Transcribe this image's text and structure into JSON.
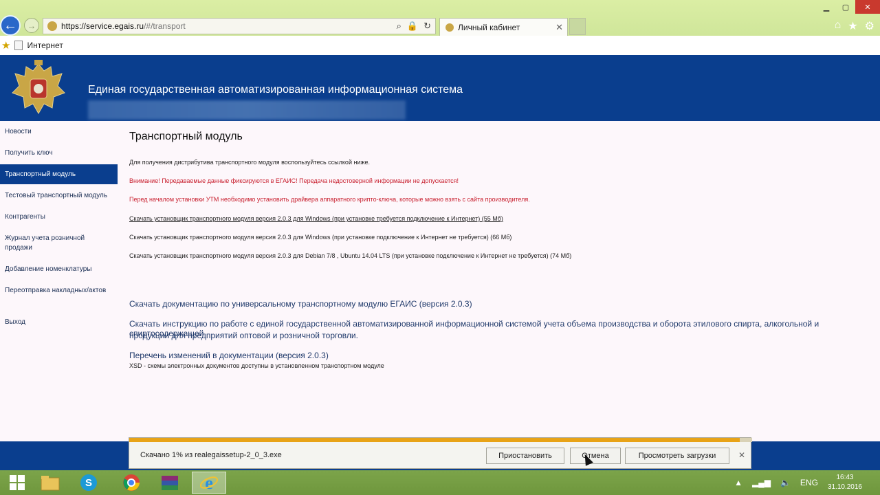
{
  "browser": {
    "url_host": "https://service.egais.ru",
    "url_rest": "/#/transport",
    "tab_title": "Личный кабинет",
    "favorites_label": "Интернет"
  },
  "header": {
    "title": "Единая государственная автоматизированная информационная система"
  },
  "sidebar": {
    "items": [
      {
        "label": "Новости"
      },
      {
        "label": "Получить ключ"
      },
      {
        "label": "Транспортный модуль"
      },
      {
        "label": "Тестовый транспортный модуль"
      },
      {
        "label": "Контрагенты"
      },
      {
        "label": "Журнал учета розничной продажи"
      },
      {
        "label": "Добавление номенклатуры"
      },
      {
        "label": "Переотправка накладных/актов"
      },
      {
        "label": "Выход"
      }
    ]
  },
  "main": {
    "title": "Транспортный модуль",
    "intro": "Для получения дистрибутива транспортного модуля воспользуйтесь ссылкой ниже.",
    "warning1": "Внимание! Передаваемые данные фиксируются в ЕГАИС! Передача недостоверной информации не допускается!",
    "warning2": "Перед началом установки УТМ необходимо установить драйвера аппаратного крипто-ключа, которые можно взять с сайта производителя.",
    "link1": "Скачать установщик транспортного модуля версия 2.0.3 для Windows (при установке требуется подключение к Интернет) (55 Мб)",
    "link2": "Скачать установщик транспортного модуля версия 2.0.3 для Windows (при установке подключение к Интернет не требуется) (66 Мб)",
    "link3": "Скачать установщик транспортного модуля версия 2.0.3 для Debian 7/8 , Ubuntu 14.04 LTS (при установке подключение к Интернет не требуется) (74 Мб)",
    "doc_link": "Скачать документацию по универсальному транспортному модулю ЕГАИС (версия 2.0.3)",
    "instr_line1": "Скачать инструкцию по работе с единой государственной автоматизированной информационной системой учета объема производства и оборота этилового спирта, алкогольной и спиртосодержащей",
    "instr_line2": "продукции для предприятий оптовой и розничной торговли.",
    "changes_link": "Перечень изменений в документации (версия 2.0.3)",
    "xsd_note": "XSD - схемы электронных документов доступны в установленном транспортном модуле"
  },
  "download": {
    "status": "Скачано 1% из realegaissetup-2_0_3.exe",
    "progress_percent": 1,
    "pause_label": "Приостановить",
    "cancel_label": "Отмена",
    "view_label": "Просмотреть загрузки"
  },
  "taskbar": {
    "language": "ENG",
    "time": "16:43",
    "date": "31.10.2016"
  },
  "colors": {
    "site_blue": "#0a3e8e",
    "warning_red": "#c81f2e",
    "download_progress": "#e8a317"
  }
}
